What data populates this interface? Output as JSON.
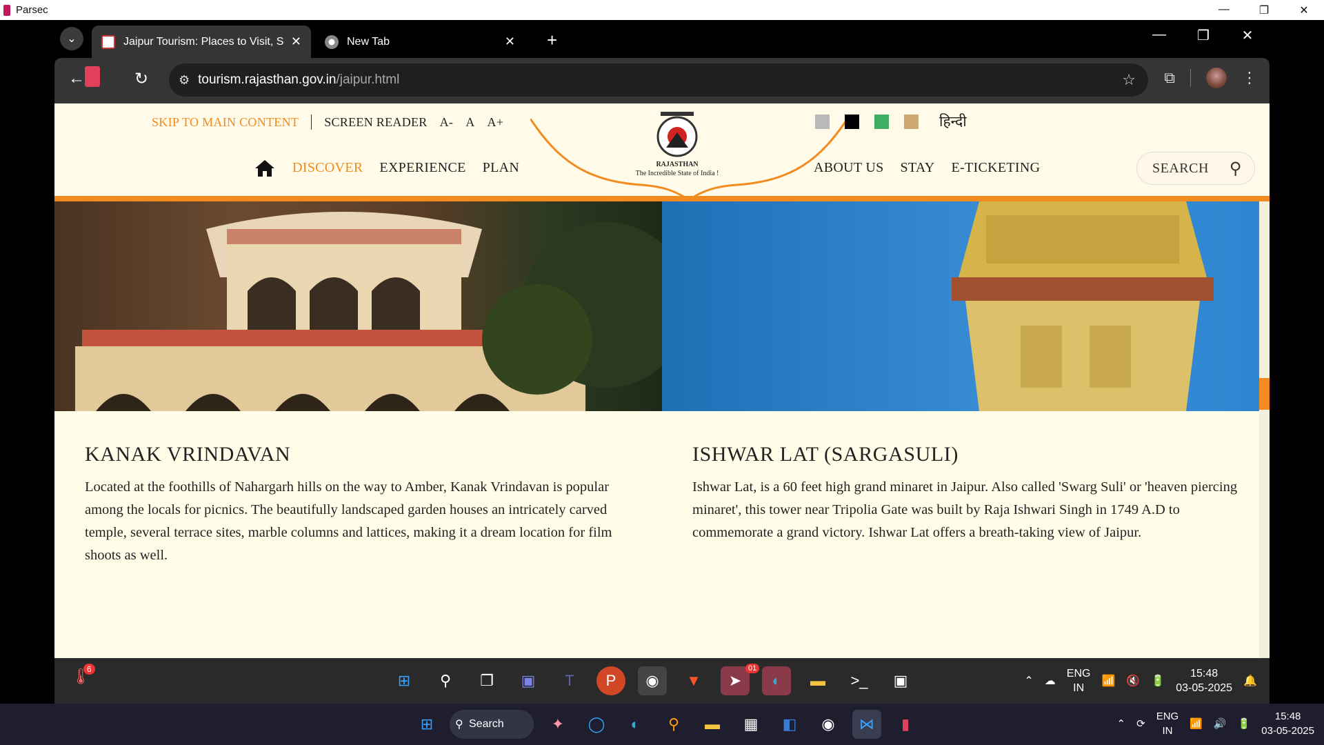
{
  "parsec": {
    "title": "Parsec"
  },
  "tabs": [
    {
      "title": "Jaipur Tourism: Places to Visit, S"
    },
    {
      "title": "New Tab"
    }
  ],
  "omnibox": {
    "host": "tourism.rajasthan.gov.in",
    "path": "/jaipur.html"
  },
  "site": {
    "skip": "SKIP TO MAIN CONTENT",
    "screen_reader": "SCREEN READER",
    "font_small": "A-",
    "font_normal": "A",
    "font_large": "A+",
    "hindi": "हिन्दी",
    "swatch_colors": [
      "#b9b9b9",
      "#000000",
      "#3fae62",
      "#cfa874"
    ],
    "nav_left": [
      "DISCOVER",
      "EXPERIENCE",
      "PLAN"
    ],
    "nav_right": [
      "ABOUT US",
      "STAY",
      "E-TICKETING"
    ],
    "search_label": "SEARCH",
    "emblem_title": "RAJASTHAN",
    "emblem_tagline": "The Incredible State of India !",
    "accent_color": "#f28b1f"
  },
  "cards": [
    {
      "title": "KANAK VRINDAVAN",
      "body": "Located at the foothills of Nahargarh hills on the way to Amber, Kanak Vrindavan is popular among the locals for picnics. The beautifully landscaped garden houses an intricately carved temple, several terrace sites, marble columns and lattices, making it a dream location for film shoots as well."
    },
    {
      "title": "ISHWAR LAT (SARGASULI)",
      "body": "Ishwar Lat, is a 60 feet high grand minaret in Jaipur. Also called 'Swarg Suli' or 'heaven piercing minaret', this tower near Tripolia Gate was built by Raja Ishwari Singh in 1749 A.D to commemorate a grand victory. Ishwar Lat offers a breath-taking view of Jaipur."
    }
  ],
  "inner_taskbar": {
    "weather_badge": "6",
    "telegram_badge": "01",
    "lang1": "ENG",
    "lang2": "IN",
    "time": "15:48",
    "date": "03-05-2025"
  },
  "host_taskbar": {
    "search_label": "Search",
    "lang1": "ENG",
    "lang2": "IN",
    "time": "15:48",
    "date": "03-05-2025"
  }
}
